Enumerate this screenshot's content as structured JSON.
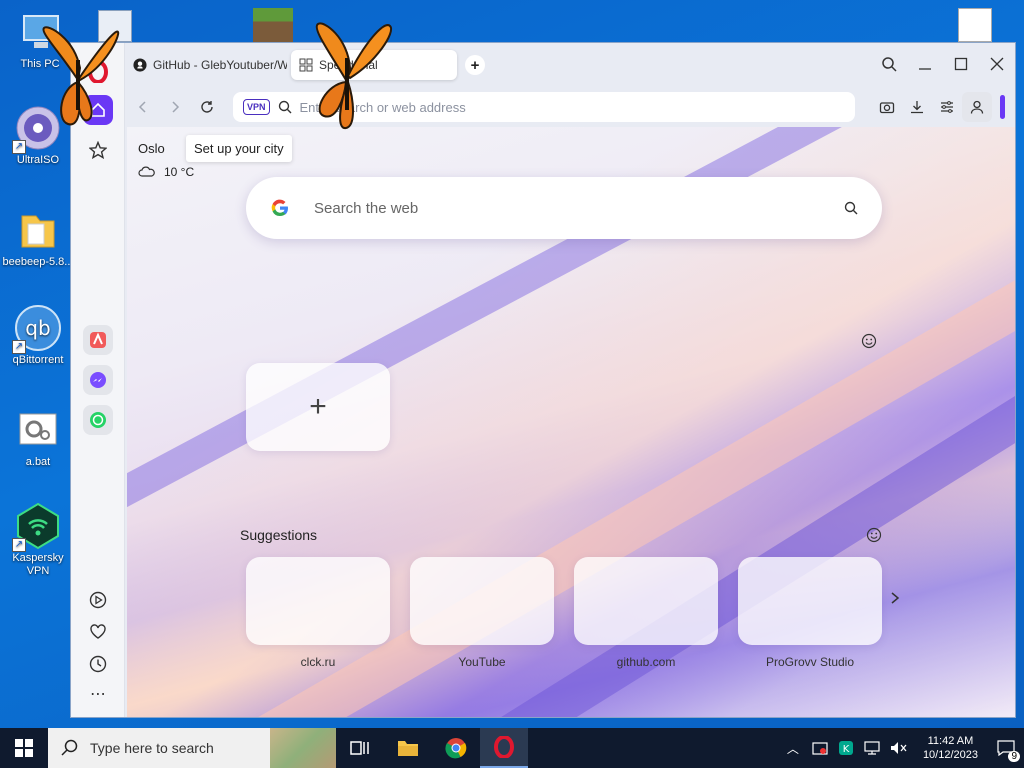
{
  "desktop": {
    "icons": [
      {
        "label": "This PC"
      },
      {
        "label": "UltraISO"
      },
      {
        "label": "beebeep-5.8..."
      },
      {
        "label": "qBittorrent"
      },
      {
        "label": "a.bat"
      },
      {
        "label": "Kaspersky VPN"
      }
    ]
  },
  "browser": {
    "tabs": [
      {
        "title": "GitHub - GlebYoutuber/W...",
        "icon": "github-icon"
      },
      {
        "title": "Speed Dial",
        "icon": "speed-dial-icon"
      }
    ],
    "new_tab_label": "+",
    "address": {
      "vpn_badge": "VPN",
      "placeholder": "Enter search or web address"
    },
    "weather": {
      "city": "Oslo",
      "tooltip": "Set up your city",
      "temperature": "10 °C"
    },
    "search": {
      "placeholder": "Search the web"
    },
    "speed_dial": {
      "add_label": "+"
    },
    "suggestions": {
      "title": "Suggestions",
      "items": [
        {
          "label": "clck.ru"
        },
        {
          "label": "YouTube"
        },
        {
          "label": "github.com"
        },
        {
          "label": "ProGrovv Studio"
        }
      ]
    },
    "accent_color": "#6a38f5"
  },
  "taskbar": {
    "search_placeholder": "Type here to search",
    "time": "11:42 AM",
    "date": "10/12/2023",
    "notification_count": "9"
  }
}
